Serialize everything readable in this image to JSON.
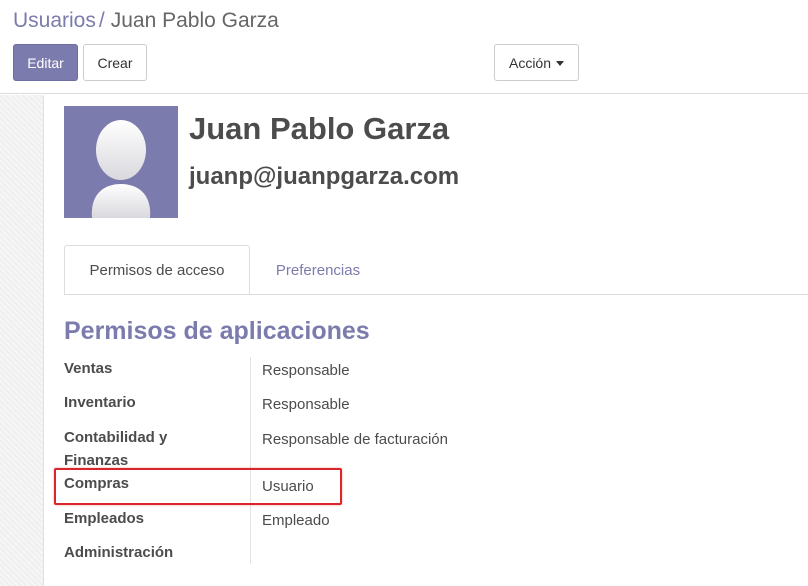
{
  "breadcrumb": {
    "parent": "Usuarios",
    "separator": "/",
    "current": "Juan Pablo Garza"
  },
  "toolbar": {
    "edit_label": "Editar",
    "create_label": "Crear",
    "action_label": "Acción"
  },
  "user": {
    "name": "Juan Pablo Garza",
    "email": "juanp@juanpgarza.com",
    "avatar_icon": "user-silhouette-icon"
  },
  "tabs": [
    {
      "label": "Permisos de acceso",
      "active": true
    },
    {
      "label": "Preferencias",
      "active": false
    }
  ],
  "section": {
    "title": "Permisos de aplicaciones"
  },
  "permissions": [
    {
      "label": "Ventas",
      "value": "Responsable"
    },
    {
      "label": "Inventario",
      "value": "Responsable"
    },
    {
      "label": "Contabilidad y Finanzas",
      "value": "Responsable de facturación"
    },
    {
      "label": "Compras",
      "value": "Usuario"
    },
    {
      "label": "Empleados",
      "value": "Empleado"
    },
    {
      "label": "Administración",
      "value": ""
    }
  ],
  "colors": {
    "brand": "#7c7bad",
    "highlight": "#d8262a"
  }
}
